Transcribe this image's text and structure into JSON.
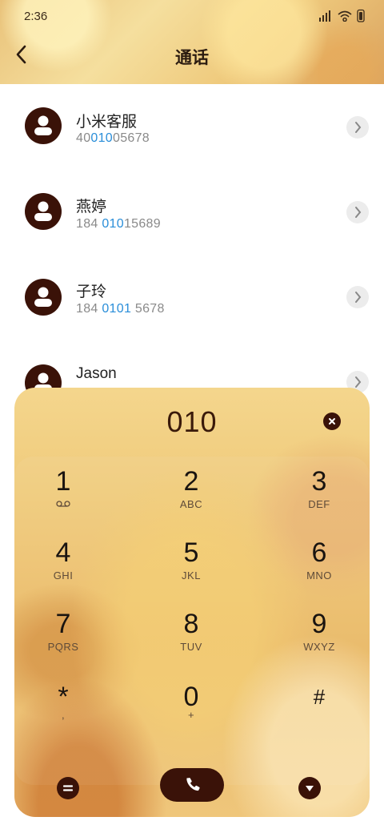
{
  "status_bar": {
    "time": "2:36"
  },
  "header": {
    "title": "通话"
  },
  "contacts": [
    {
      "name": "小米客服",
      "number_pre": "40",
      "number_match": "010",
      "number_post": "05678"
    },
    {
      "name": "燕婷",
      "number_pre": "184 ",
      "number_match": "010",
      "number_post": "15689"
    },
    {
      "name": "子玲",
      "number_pre": "184 ",
      "number_match": "0101",
      "number_post": " 5678"
    },
    {
      "name": "Jason",
      "number_pre": "",
      "number_match": "",
      "number_post": ""
    }
  ],
  "dialpad": {
    "entered_number": "010",
    "keys": [
      {
        "digit": "1",
        "letters": ""
      },
      {
        "digit": "2",
        "letters": "ABC"
      },
      {
        "digit": "3",
        "letters": "DEF"
      },
      {
        "digit": "4",
        "letters": "GHI"
      },
      {
        "digit": "5",
        "letters": "JKL"
      },
      {
        "digit": "6",
        "letters": "MNO"
      },
      {
        "digit": "7",
        "letters": "PQRS"
      },
      {
        "digit": "8",
        "letters": "TUV"
      },
      {
        "digit": "9",
        "letters": "WXYZ"
      },
      {
        "digit": "*",
        "letters": ","
      },
      {
        "digit": "0",
        "letters": "+"
      },
      {
        "digit": "#",
        "letters": ""
      }
    ]
  },
  "colors": {
    "accent_dark": "#3a1208",
    "match_highlight": "#2a8ed9"
  },
  "icons": {
    "back": "back-arrow-icon",
    "avatar": "person-icon",
    "chevron": "chevron-right-icon",
    "clear": "clear-x-icon",
    "voicemail": "voicemail-icon",
    "menu": "equals-menu-icon",
    "call": "phone-icon",
    "collapse": "triangle-down-icon"
  }
}
